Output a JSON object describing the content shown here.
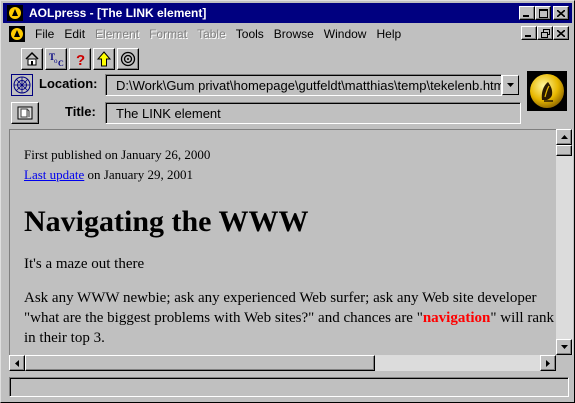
{
  "window": {
    "title": "AOLpress - [The LINK element]",
    "caption": {
      "minimize": "_",
      "maximize": "□",
      "close": "×"
    }
  },
  "menu": {
    "items": [
      {
        "label": "File",
        "enabled": true
      },
      {
        "label": "Edit",
        "enabled": true
      },
      {
        "label": "Element",
        "enabled": false
      },
      {
        "label": "Format",
        "enabled": false
      },
      {
        "label": "Table",
        "enabled": false
      },
      {
        "label": "Tools",
        "enabled": true
      },
      {
        "label": "Browse",
        "enabled": true
      },
      {
        "label": "Window",
        "enabled": true
      },
      {
        "label": "Help",
        "enabled": true
      }
    ]
  },
  "toolbar": {
    "buttons": [
      {
        "name": "home",
        "icon": "home-icon"
      },
      {
        "name": "toc",
        "icon": "toc-icon"
      },
      {
        "name": "help",
        "icon": "help-icon"
      },
      {
        "name": "up",
        "icon": "up-arrow-icon"
      },
      {
        "name": "target",
        "icon": "target-icon"
      }
    ]
  },
  "location": {
    "label": "Location:",
    "value": "D:\\Work\\Gum privat\\homepage\\gutfeldt\\matthias\\temp\\tekelenb.htm"
  },
  "title_field": {
    "label": "Title:",
    "value": "The LINK element"
  },
  "document": {
    "published": "First published on January 26, 2000",
    "update_link": "Last update",
    "update_rest": " on January 29, 2001",
    "heading": "Navigating the WWW",
    "para1": "It's a maze out there",
    "para2_a": "Ask any WWW newbie; ask any experienced Web surfer; ask any Web site developer \"what are the biggest problems with Web sites?\" and chances are \"",
    "para2_bold": "navigation",
    "para2_b": "\" will rank in their top 3."
  },
  "statusbar": {
    "text": ""
  },
  "colors": {
    "titlebar": "#000080",
    "face": "#c0c0c0",
    "link": "#0000ee",
    "emphasis": "#ff0000"
  }
}
